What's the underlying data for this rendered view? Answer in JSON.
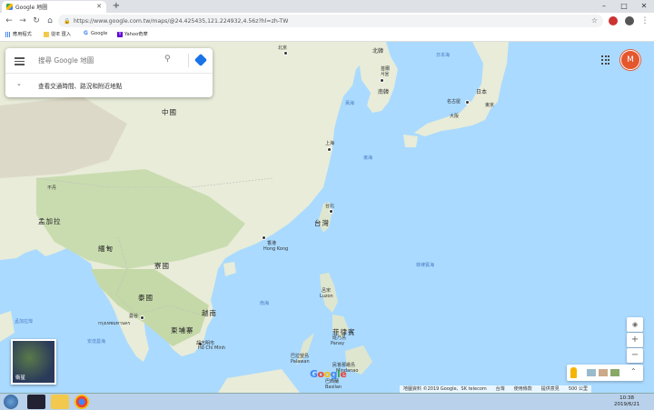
{
  "browser": {
    "tab_title": "Google 地圖",
    "new_tab": "+",
    "url": "https://www.google.com.tw/maps/@24.425435,121.224932,4.56z?hl=zh-TW",
    "window_controls": [
      "–",
      "□",
      "✕"
    ]
  },
  "bookmarks": [
    {
      "label": "應用程式",
      "icon": "apps-grid-icon"
    },
    {
      "label": "從IE 匯入",
      "icon": "folder-icon"
    },
    {
      "label": "Google",
      "icon": "google-g-icon"
    },
    {
      "label": "Yahoo奇摩",
      "icon": "yahoo-icon"
    }
  ],
  "searchbox": {
    "placeholder": "搜尋 Google 地圖",
    "traffic_toggle": "查看交通時間、路況和附近地點"
  },
  "account": {
    "initial": "M"
  },
  "map": {
    "countries": [
      "中國",
      "北韓",
      "南韓",
      "日本",
      "緬甸",
      "寮國",
      "泰國",
      "柬埔寨",
      "越南",
      "菲律賓",
      "孟加拉",
      "台灣",
      "不丹"
    ],
    "cities": [
      "北京",
      "首爾",
      "서울",
      "名古屋",
      "東京",
      "大阪",
      "上海",
      "台北",
      "香港",
      "Hong Kong",
      "曼谷",
      "กรุงเทพมหานคร",
      "胡志明市",
      "Hồ Chí Minh",
      "呂宋",
      "Luzon",
      "班乃島",
      "Panay",
      "巴拉望島",
      "Palawan",
      "民答那峨島",
      "Mindanao",
      "巴西蘭",
      "Basilan"
    ],
    "seas": [
      "日本海",
      "黃海",
      "東海",
      "南海",
      "菲律賓海",
      "孟加拉灣",
      "安達曼海"
    ]
  },
  "layers": {
    "satellite_label": "衛星"
  },
  "controls": {
    "zoom_in": "+",
    "zoom_out": "−",
    "locate": "◉",
    "expand": "⌃"
  },
  "logo": {
    "G": "G",
    "o1": "o",
    "o2": "o",
    "g": "g",
    "l": "l",
    "e": "e"
  },
  "footer": {
    "items": [
      "地圖資料 ©2019 Google、SK telecom",
      "台灣",
      "使用條款",
      "提供意見",
      "500 公里"
    ]
  },
  "taskbar": {
    "time": "10:38",
    "date": "2019/6/21"
  },
  "colors": {
    "sea": "#aadaff",
    "land": "#e8ecd8",
    "forest": "#c9dcb0",
    "accent": "#1a73e8",
    "avatar": "#e4572e"
  }
}
